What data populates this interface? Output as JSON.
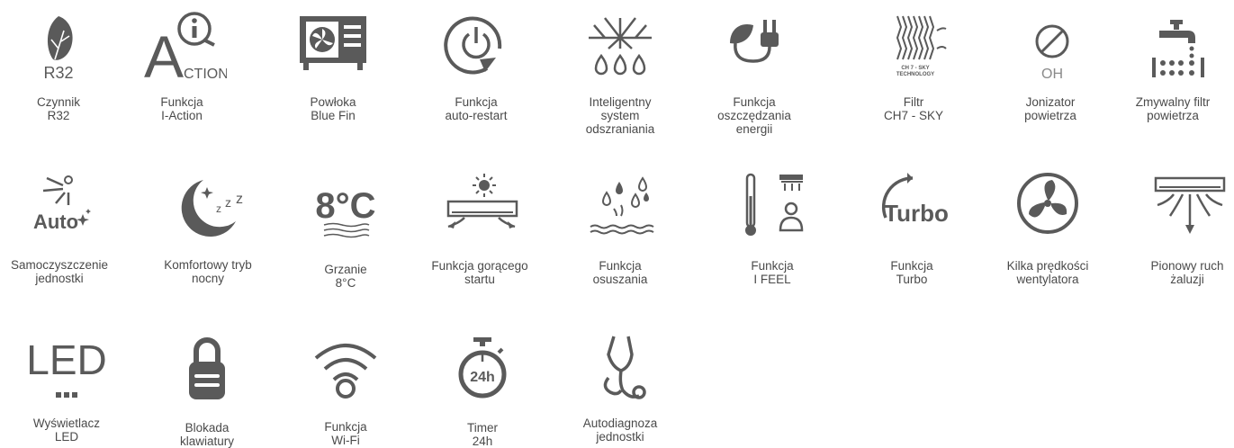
{
  "features": [
    {
      "icon": "leaf-icon",
      "icon_text": "R32",
      "label": "Czynnik\nR32"
    },
    {
      "icon": "i-action-icon",
      "icon_text": "A",
      "icon_sub": "CTION",
      "label": "Funkcja\nI-Action"
    },
    {
      "icon": "outdoor-unit-icon",
      "label": "Powłoka\nBlue Fin"
    },
    {
      "icon": "power-restart-icon",
      "label": "Funkcja\nauto-restart"
    },
    {
      "icon": "defrost-icon",
      "label": "Inteligentny\nsystem\nodszraniania"
    },
    {
      "icon": "leaf-plug-icon",
      "label": "Funkcja\noszczędzania\nenergii"
    },
    {
      "icon": "filter-icon",
      "icon_text": "CH 7 - SKY\nTECHNOLOGY",
      "label": "Filtr\nCH7 - SKY"
    },
    {
      "icon": "ionizer-icon",
      "icon_text": "OH",
      "label": "Jonizator\npowietrza"
    },
    {
      "icon": "washable-filter-icon",
      "label": "Zmywalny filtr\npowietrza"
    },
    {
      "icon": "auto-clean-icon",
      "icon_text": "Auto",
      "label": "Samoczyszczenie\njednostki"
    },
    {
      "icon": "moon-icon",
      "icon_text": "z z z",
      "label": "Komfortowy tryb\nnocny"
    },
    {
      "icon": "heat-8c-icon",
      "icon_text": "8°C",
      "label": "Grzanie\n8°C"
    },
    {
      "icon": "hot-start-icon",
      "label": "Funkcja gorącego\nstartu"
    },
    {
      "icon": "dehumidify-icon",
      "label": "Funkcja\nosuszania"
    },
    {
      "icon": "i-feel-icon",
      "label": "Funkcja\nI FEEL"
    },
    {
      "icon": "turbo-icon",
      "icon_text": "Turbo",
      "label": "Funkcja\nTurbo"
    },
    {
      "icon": "fan-icon",
      "label": "Kilka prędkości\nwentylatora"
    },
    {
      "icon": "vertical-swing-icon",
      "label": "Pionowy ruch\nżaluzji"
    },
    {
      "icon": "led-icon",
      "icon_text": "LED",
      "label": "Wyświetlacz\nLED"
    },
    {
      "icon": "padlock-icon",
      "label": "Blokada\nklawiatury"
    },
    {
      "icon": "wifi-icon",
      "label": "Funkcja\nWi-Fi"
    },
    {
      "icon": "timer-icon",
      "icon_text": "24h",
      "label": "Timer\n24h"
    },
    {
      "icon": "stethoscope-icon",
      "label": "Autodiagnoza\njednostki"
    }
  ],
  "colors": {
    "icon": "#5a5a5a",
    "text": "#4a4a4a",
    "background": "#ffffff"
  }
}
